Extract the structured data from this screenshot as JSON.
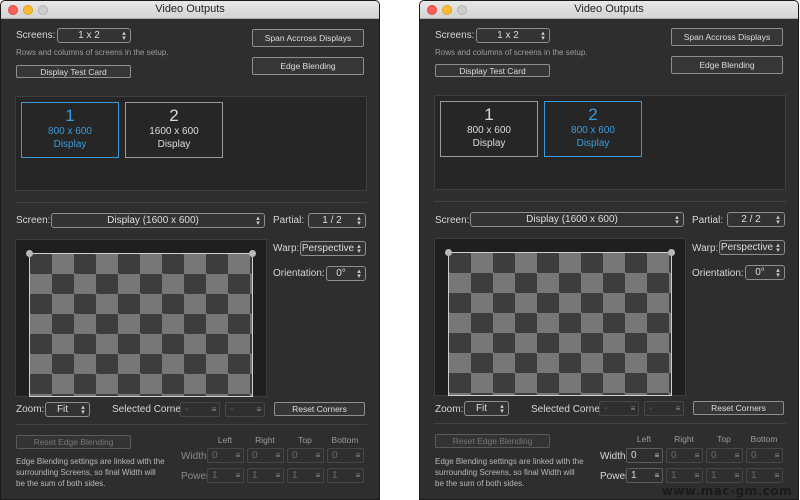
{
  "window_title": "Video Outputs",
  "screens": {
    "label": "Screens:",
    "value": "1 x 2",
    "hint": "Rows and columns of screens in the setup."
  },
  "buttons": {
    "span": "Span Accross Displays",
    "edge_blending": "Edge Blending",
    "test_card": "Display Test Card",
    "reset_corners": "Reset Corners",
    "reset_edge": "Reset Edge Blending"
  },
  "screen_select": {
    "label": "Screen:",
    "value": "Display (1600 x 600)"
  },
  "partial": {
    "label": "Partial:"
  },
  "warp": {
    "label": "Warp:",
    "value": "Perspective"
  },
  "orientation": {
    "label": "Orientation:",
    "value": "0°"
  },
  "zoom": {
    "label": "Zoom:",
    "value": "Fit"
  },
  "selected_corner": {
    "label": "Selected Corner:",
    "x": "-",
    "y": "-"
  },
  "edge_note": "Edge Blending settings are linked with the surrounding Screens, so final Width will be the sum of both sides.",
  "edge_cols": [
    "Left",
    "Right",
    "Top",
    "Bottom"
  ],
  "edge_rows": {
    "width": "Width:",
    "power": "Power:"
  },
  "windows": [
    {
      "screens": [
        {
          "num": "1",
          "res": "800 x 600",
          "kind": "Display",
          "selected": true
        },
        {
          "num": "2",
          "res": "1600 x 600",
          "kind": "Display",
          "selected": false
        }
      ],
      "partial_value": "1 / 2",
      "width_vals": [
        "0",
        "0",
        "0",
        "0"
      ],
      "power_vals": [
        "1",
        "1",
        "1",
        "1"
      ]
    },
    {
      "screens": [
        {
          "num": "1",
          "res": "800 x 600",
          "kind": "Display",
          "selected": false
        },
        {
          "num": "2",
          "res": "800 x 600",
          "kind": "Display",
          "selected": true
        }
      ],
      "partial_value": "2 / 2",
      "width_vals": [
        "0",
        "0",
        "0",
        "0"
      ],
      "power_vals": [
        "1",
        "1",
        "1",
        "1"
      ]
    }
  ],
  "watermark": "www.mac-gm.com"
}
